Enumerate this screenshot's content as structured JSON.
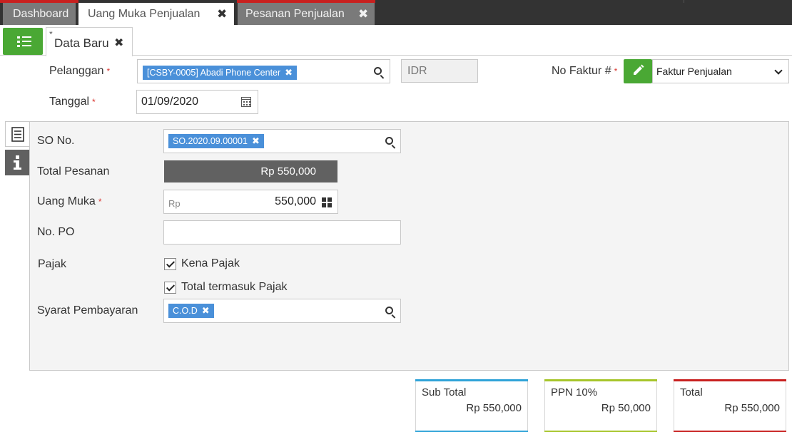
{
  "top_tabs": [
    {
      "label": "Dashboard",
      "close": ""
    },
    {
      "label": "Uang Muka Penjualan",
      "close": "✖"
    },
    {
      "label": "Pesanan Penjualan",
      "close": "✖"
    }
  ],
  "doc_tab": {
    "marker": "*",
    "label": "Data Baru",
    "close": "✖"
  },
  "header": {
    "pelanggan_label": "Pelanggan",
    "pelanggan_value": "[CSBY-0005] Abadi Phone Center",
    "currency": "IDR",
    "no_faktur_label": "No Faktur #",
    "no_faktur_select": "Faktur Penjualan",
    "tanggal_label": "Tanggal",
    "tanggal_value": "01/09/2020",
    "required_mark": "*",
    "chip_remove": "✖"
  },
  "form": {
    "so_no_label": "SO No.",
    "so_no_value": "SO.2020.09.00001",
    "total_pesanan_label": "Total Pesanan",
    "total_pesanan_value": "Rp 550,000",
    "uang_muka_label": "Uang Muka",
    "uang_muka_prefix": "Rp",
    "uang_muka_value": "550,000",
    "no_po_label": "No. PO",
    "no_po_value": "",
    "pajak_label": "Pajak",
    "kena_pajak_label": "Kena Pajak",
    "total_termasuk_pajak_label": "Total termasuk Pajak",
    "syarat_label": "Syarat Pembayaran",
    "syarat_value": "C.O.D"
  },
  "totals": [
    {
      "label": "Sub Total",
      "value": "Rp 550,000",
      "color": "#2fa3d8"
    },
    {
      "label": "PPN 10%",
      "value": "Rp 50,000",
      "color": "#a6c52a"
    },
    {
      "label": "Total",
      "value": "Rp 550,000",
      "color": "#c8201f"
    }
  ],
  "colors": {
    "accent_green": "#4aa834",
    "chip_blue": "#4a90d9",
    "required_red": "#d9352f"
  }
}
